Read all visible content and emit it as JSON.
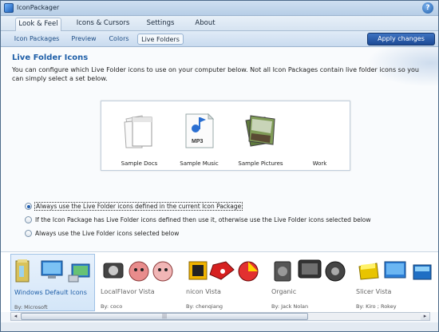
{
  "window": {
    "title": "IconPackager"
  },
  "tabs": [
    {
      "label": "Look & Feel",
      "active": true
    },
    {
      "label": "Icons & Cursors",
      "active": false
    },
    {
      "label": "Settings",
      "active": false
    },
    {
      "label": "About",
      "active": false
    }
  ],
  "subtabs": [
    {
      "label": "Icon Packages",
      "active": false
    },
    {
      "label": "Preview",
      "active": false
    },
    {
      "label": "Colors",
      "active": false
    },
    {
      "label": "Live Folders",
      "active": true
    }
  ],
  "apply_button": "Apply changes",
  "section": {
    "title": "Live Folder Icons",
    "description": "You can configure which Live Folder icons to use on your computer below. Not all Icon Packages contain live folder icons so you can simply select a set below."
  },
  "preview_items": [
    {
      "label": "Sample Docs",
      "icon": "docs-folder-icon"
    },
    {
      "label": "Sample Music",
      "icon": "music-folder-icon"
    },
    {
      "label": "Sample Pictures",
      "icon": "pictures-folder-icon"
    },
    {
      "label": "Work",
      "icon": "work-folder-icon"
    }
  ],
  "options": [
    {
      "label": "Always use the Live Folder icons defined in the current Icon Package",
      "checked": true
    },
    {
      "label": "If the Icon Package has Live Folder icons defined then use it, otherwise use the Live Folder icons selected below",
      "checked": false
    },
    {
      "label": "Always use the Live Folder icons selected below",
      "checked": false
    }
  ],
  "packages": [
    {
      "name": "Windows Default Icons",
      "author": "By: Microsoft",
      "selected": true
    },
    {
      "name": "LocalFlavor Vista",
      "author": "By: coco",
      "selected": false
    },
    {
      "name": "nicon Vista",
      "author": "By: chenqiang",
      "selected": false
    },
    {
      "name": "Organic",
      "author": "By: Jack Nolan",
      "selected": false
    },
    {
      "name": "Slicer Vista",
      "author": "By: Kiro ; Rokey",
      "selected": false
    }
  ],
  "colors": {
    "accent": "#1f5fa8",
    "apply_button": "#1c4a95"
  }
}
